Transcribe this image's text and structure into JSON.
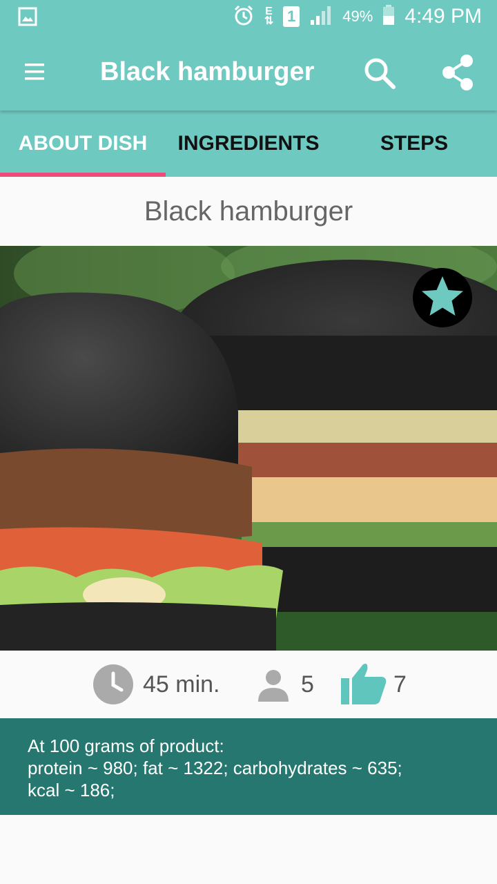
{
  "status_bar": {
    "battery_percent": "49%",
    "time": "4:49 PM",
    "sim_label": "1",
    "network_label": "E"
  },
  "app_bar": {
    "title": "Black hamburger"
  },
  "tabs": [
    {
      "label": "ABOUT DISH",
      "active": true
    },
    {
      "label": "INGREDIENTS",
      "active": false
    },
    {
      "label": "STEPS",
      "active": false
    }
  ],
  "dish": {
    "title": "Black hamburger"
  },
  "stats": {
    "time": "45 min.",
    "servings": "5",
    "likes": "7"
  },
  "nutrition": {
    "line1": "At 100 grams of product:",
    "line2": "protein ~ 980; fat ~ 1322; carbohydrates ~ 635;",
    "line3": "kcal ~ 186;"
  },
  "colors": {
    "primary": "#6ec9c1",
    "tab_indicator": "#ee4a7a",
    "nutrition_bg": "#25776f",
    "favorite_star": "#6ec9c1",
    "like_icon": "#5fc5bd"
  },
  "icons": {
    "status_left": "gallery-icon",
    "alarm": "alarm-icon",
    "signal": "signal-icon",
    "battery": "battery-icon",
    "menu": "menu-icon",
    "search": "search-icon",
    "share": "share-icon",
    "favorite": "star-icon",
    "time": "clock-icon",
    "servings": "person-icon",
    "likes": "thumbs-up-icon"
  }
}
